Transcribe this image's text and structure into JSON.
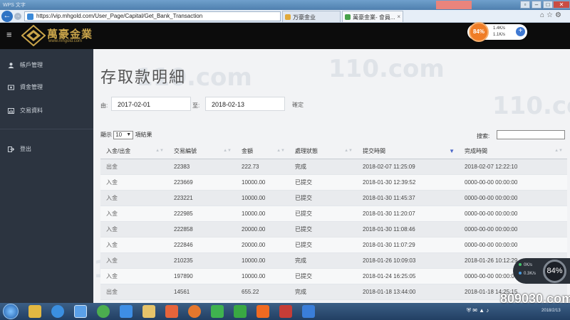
{
  "browser": {
    "url": "https://vip.mhgold.com/User_Page/Capital/Get_Bank_Transaction",
    "titlebar_text": "WPS 文字",
    "titlebar_ad": "",
    "tabs": [
      {
        "label": "万豪金业"
      },
      {
        "label": "萬豪金業- 會員..."
      }
    ]
  },
  "site": {
    "logo_text": "萬豪金業",
    "logo_url": "www.mhgold.com"
  },
  "net_widget": {
    "percent": "84%",
    "up": "1.4K/s",
    "down": "1.1K/s"
  },
  "sidebar": {
    "items": [
      {
        "label": "帳戶管理",
        "icon": "user-icon"
      },
      {
        "label": "資金管理",
        "icon": "wallet-icon"
      },
      {
        "label": "交易資料",
        "icon": "chart-icon"
      },
      {
        "label": "登出",
        "icon": "logout-icon"
      }
    ]
  },
  "main": {
    "title": "存取款明細",
    "filter": {
      "from_label": "由:",
      "from_value": "2017-02-01",
      "to_label": "至:",
      "to_value": "2018-02-13",
      "confirm_label": "確定"
    },
    "length": {
      "prefix": "顯示",
      "value": "10",
      "suffix": "項結果"
    },
    "search_label": "搜索:",
    "table": {
      "headers": [
        "入金/出金",
        "交易編號",
        "金額",
        "處理狀態",
        "提交時間",
        "完成時間"
      ],
      "rows": [
        [
          "出金",
          "22383",
          "222.73",
          "完成",
          "2018-02-07 11:25:09",
          "2018-02-07 12:22:10"
        ],
        [
          "入金",
          "223669",
          "10000.00",
          "已提交",
          "2018-01-30 12:39:52",
          "0000-00-00 00:00:00"
        ],
        [
          "入金",
          "223221",
          "10000.00",
          "已提交",
          "2018-01-30 11:45:37",
          "0000-00-00 00:00:00"
        ],
        [
          "入金",
          "222985",
          "10000.00",
          "已提交",
          "2018-01-30 11:20:07",
          "0000-00-00 00:00:00"
        ],
        [
          "入金",
          "222858",
          "20000.00",
          "已提交",
          "2018-01-30 11:08:46",
          "0000-00-00 00:00:00"
        ],
        [
          "入金",
          "222846",
          "20000.00",
          "已提交",
          "2018-01-30 11:07:29",
          "0000-00-00 00:00:00"
        ],
        [
          "入金",
          "210235",
          "10000.00",
          "完成",
          "2018-01-26 10:09:03",
          "2018-01-26 10:12:29"
        ],
        [
          "入金",
          "197890",
          "10000.00",
          "已提交",
          "2018-01-24 16:25:05",
          "0000-00-00 00:00:00"
        ],
        [
          "出金",
          "14561",
          "655.22",
          "完成",
          "2018-01-18 13:44:00",
          "2018-01-18 14:25:15"
        ]
      ]
    }
  },
  "speed_widget": {
    "up": "0K/s",
    "down": "0.3K/s",
    "percent": "84%"
  },
  "overlay_brand": "809030.com",
  "overlay_brand_date": "2018/2/13",
  "watermark": "110.com",
  "colors": {
    "sidebar_bg": "#2c3440",
    "header_bg": "#0c0c0c",
    "logo_gold": "#c9a44a",
    "sort_active": "#4b66c8"
  }
}
